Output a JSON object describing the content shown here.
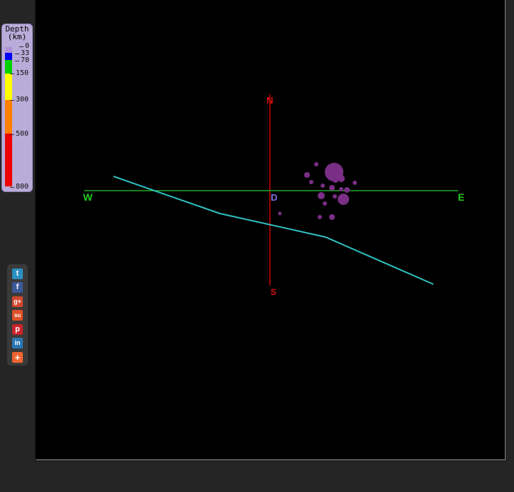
{
  "legend": {
    "title_line1": "Depth",
    "title_line2": "(km)",
    "ticks": [
      "0",
      "33",
      "70",
      "150",
      "300",
      "500",
      "800"
    ],
    "colors": {
      "shallow": "#b090d8",
      "d0_33": "#b090d8",
      "d33_70": "#0000ff",
      "d70_150": "#00d000",
      "d150_300": "#ffff00",
      "d300_500": "#ff8000",
      "d500_800": "#ee0000"
    }
  },
  "compass": {
    "north": "N",
    "south": "S",
    "west": "W",
    "east": "E",
    "center": "D"
  },
  "colors": {
    "ns_axis": "#cc0000",
    "we_axis": "#22aa22",
    "plate_line": "#30c0c0",
    "quake": "#7a2e86",
    "center_label": "#7f6fe0"
  },
  "share": {
    "items": [
      {
        "icon": "twitter-icon",
        "glyph": "t",
        "color": "#2b8ec3"
      },
      {
        "icon": "facebook-icon",
        "glyph": "f",
        "color": "#3b5998"
      },
      {
        "icon": "google-plus-icon",
        "glyph": "g+",
        "color": "#d2482f"
      },
      {
        "icon": "stumbleupon-icon",
        "glyph": "su",
        "color": "#e0502a"
      },
      {
        "icon": "pinterest-icon",
        "glyph": "p",
        "color": "#c8232c"
      },
      {
        "icon": "linkedin-icon",
        "glyph": "in",
        "color": "#2a78b5"
      },
      {
        "icon": "add-more-icon",
        "glyph": "+",
        "color": "#f0632f"
      }
    ]
  }
}
